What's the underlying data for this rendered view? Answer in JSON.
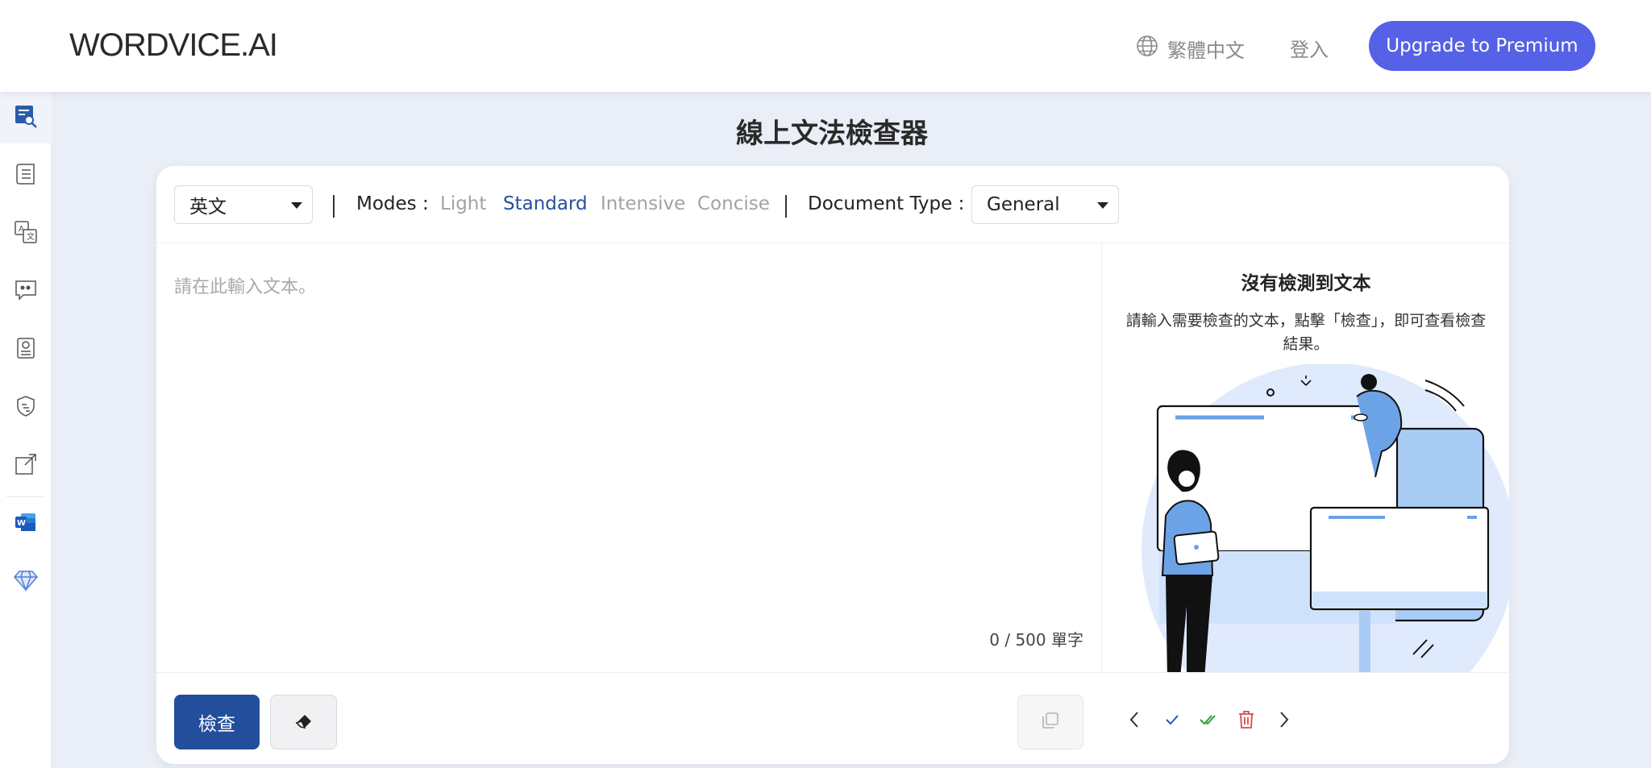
{
  "header": {
    "logo": "WORDVICE.AI",
    "language": "繁體中文",
    "login": "登入",
    "premium_button": "Upgrade to Premium"
  },
  "sidebar": {
    "items": [
      {
        "icon": "grammar-check-icon",
        "active": true
      },
      {
        "icon": "document-list-icon"
      },
      {
        "icon": "translate-icon"
      },
      {
        "icon": "chat-quote-icon"
      },
      {
        "icon": "certificate-icon"
      },
      {
        "icon": "shield-ai-icon"
      },
      {
        "icon": "external-link-icon"
      },
      {
        "icon": "word-addin-icon"
      },
      {
        "icon": "diamond-icon"
      }
    ]
  },
  "main": {
    "title": "線上文法檢查器"
  },
  "toolbar": {
    "language_select": "英文",
    "modes_label": "Modes :",
    "modes": [
      "Light",
      "Standard",
      "Intensive",
      "Concise"
    ],
    "active_mode": "Standard",
    "doc_type_label": "Document Type :",
    "doc_type_select": "General"
  },
  "editor": {
    "placeholder": "請在此輸入文本。",
    "word_count": "0 / 500 單字"
  },
  "results": {
    "title": "沒有檢測到文本",
    "description": "請輸入需要檢查的文本，點擊「檢查」，即可查看檢查結果。"
  },
  "actions": {
    "check_button": "檢查"
  },
  "colors": {
    "primary": "#234e9c",
    "premium": "#5561e6",
    "active_mode": "#264f9c",
    "background": "#eaeef7"
  }
}
